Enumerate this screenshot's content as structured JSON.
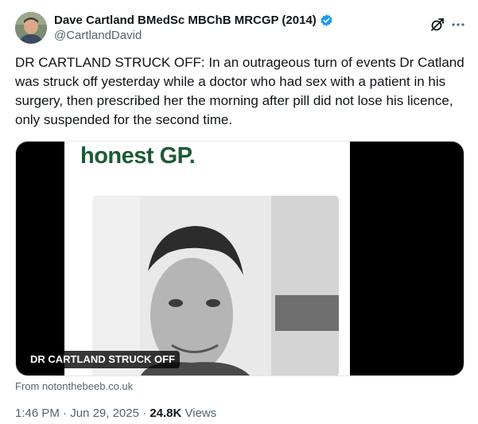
{
  "author": {
    "display_name": "Dave Cartland BMedSc MBChB MRCGP (2014)",
    "handle": "@CartlandDavid",
    "verified_color": "#1d9bf0"
  },
  "post": {
    "text": "DR CARTLAND STRUCK OFF: In an outrageous turn of events Dr Catland was struck off yesterday while a doctor who had sex with a patient in his surgery, then prescribed her the morning after pill did not lose his licence, only suspended for the second time."
  },
  "media": {
    "headline": "honest GP.",
    "caption": "DR CARTLAND STRUCK OFF",
    "headline_color": "#1c5a36"
  },
  "card": {
    "source": "From notonthebeeb.co.uk"
  },
  "meta": {
    "time": "1:46 PM",
    "separator": "·",
    "date": "Jun 29, 2025",
    "views_count": "24.8K",
    "views_label": "Views"
  },
  "icons": [
    "verified-icon",
    "grok-icon",
    "more-icon"
  ]
}
